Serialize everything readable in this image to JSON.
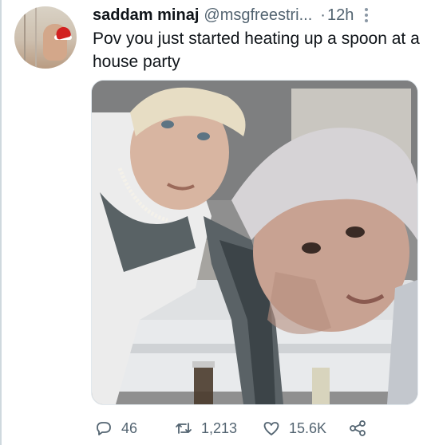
{
  "tweet": {
    "display_name": "saddam minaj",
    "handle": "@msgfreestri...",
    "separator": "·",
    "time": "12h",
    "text": "Pov you just started heating up a spoon at a house party"
  },
  "icons": {
    "more": "more-dots-vertical-icon",
    "reply": "reply-bubble-icon",
    "retweet": "retweet-arrows-icon",
    "like": "heart-icon",
    "share": "share-icon"
  },
  "actions": {
    "replies": "46",
    "retweets": "1,213",
    "likes": "15.6K"
  },
  "colors": {
    "text": "#0f1419",
    "secondary": "#536471",
    "divider": "#cfd9de"
  }
}
